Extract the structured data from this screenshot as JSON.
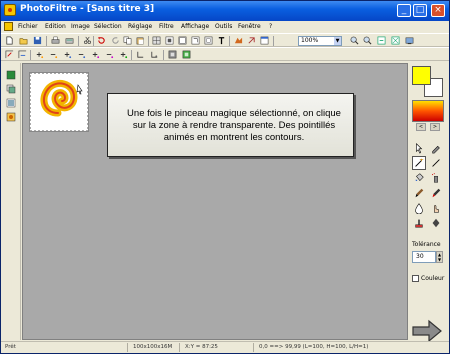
{
  "window": {
    "title": "PhotoFiltre - [Sans titre 3]",
    "min_label": "_",
    "max_label": "□",
    "close_label": "×"
  },
  "menu": {
    "items": [
      "Fichier",
      "Edition",
      "Image",
      "Sélection",
      "Réglage",
      "Filtre",
      "Affichage",
      "Outils",
      "Fenêtre",
      "?"
    ]
  },
  "toolbar": {
    "zoom_value": "100%",
    "zoom_arrow": "▼"
  },
  "callout": {
    "text": "Une fois le pinceau magique sélectionné, on clique sur la zone à rendre transparente. Des pointillés animés en montrent les contours."
  },
  "palette": {
    "foreground_color": "#ffff00",
    "background_color": "#ffffff",
    "grad_prev": "<",
    "grad_next": ">"
  },
  "tool_options": {
    "tolerance_label": "Tolérance",
    "tolerance_value": "30",
    "couleur_label": "Couleur"
  },
  "status": {
    "ready": "Prêt",
    "dimensions": "100x100x16M",
    "coords": "X:Y = 87:25",
    "color_info": "0,0 ==> 99,99 (L=100, H=100, L/H=1)"
  },
  "icons": {
    "title_icon": "photofiltre-icon",
    "navigation_arrow": "arrow-right-icon"
  }
}
